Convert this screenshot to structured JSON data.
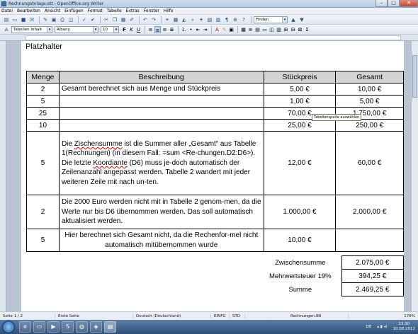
{
  "window": {
    "title": "RechnungVorlage.ott - OpenOffice.org Writer",
    "min": "–",
    "max": "□",
    "close": "✕"
  },
  "menu": [
    "Datei",
    "Bearbeiten",
    "Ansicht",
    "Einfügen",
    "Format",
    "Tabelle",
    "Extras",
    "Fenster",
    "Hilfe"
  ],
  "toolbar": {
    "find_placeholder": "Finden",
    "paragraph_style": "Tabellen Inhalt",
    "font_name": "Albany",
    "font_size": "10"
  },
  "document": {
    "heading": "Platzhalter",
    "table": {
      "headers": [
        "Menge",
        "Beschreibung",
        "Stückpreis",
        "Gesamt"
      ],
      "rows": [
        {
          "qty": "2",
          "desc": "Gesamt berechnet sich aus Menge und Stückpreis",
          "price": "5,00 €",
          "total": "10,00 €"
        },
        {
          "qty": "5",
          "desc": "",
          "price": "1,00 €",
          "total": "5,00 €"
        },
        {
          "qty": "25",
          "desc": "",
          "price": "70,00 €",
          "total": "1.750,00 €"
        },
        {
          "qty": "10",
          "desc": "",
          "price": "25,00 €",
          "total": "250,00 €"
        },
        {
          "qty": "5",
          "desc_parts": [
            "Die ",
            "Zischensumme",
            " ist die Summer aller „Gesamt“ aus Tabelle 1(Rechnungen) (in diesem Fall: =sum <Re-chungen.D2:D6>). Die letzte ",
            "Koordiante",
            " (D6) muss je-doch automatisch der Zeilenanzahl angepasst werden. Tabelle 2 wandert mit jeder weiteren Zeile mit nach un-ten."
          ],
          "price": "12,00 €",
          "total": "60,00 €"
        },
        {
          "qty": "2",
          "desc": "Die 2000 Euro werden nicht mit in Tabelle 2 genom-men, da die Werte nur bis D6 übernommen werden. Das soll automatisch aktualisiert werden.",
          "price": "1.000,00 €",
          "total": "2.000,00 €"
        },
        {
          "qty": "5",
          "desc": "Hier berechnet sich Gesamt nicht, da die Rechenfor-mel nicht automatisch mitübernommen wurde",
          "price": "10,00 €",
          "total": ""
        }
      ]
    },
    "tooltip": "Tabellenspalte auswählen",
    "summary": [
      {
        "label": "Zwischensumme",
        "value": "2.075,00 €"
      },
      {
        "label": "Mehrwertsteuer 19%",
        "value": "394,25 €"
      },
      {
        "label": "Summe",
        "value": "2.469,25 €"
      }
    ]
  },
  "statusbar": {
    "page": "Seite 1 / 2",
    "page_style": "Erste Seite",
    "language": "Deutsch (Deutschland)",
    "insert_mode": "EINFG",
    "selection_mode": "STD",
    "cell": "Rechnungen.B8",
    "zoom": "178%"
  },
  "taskbar": {
    "language": "DE",
    "time": "13:30",
    "date": "10.08.2012"
  }
}
